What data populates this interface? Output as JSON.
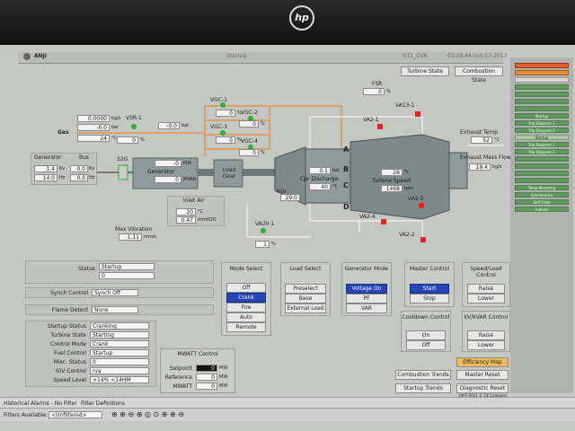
{
  "header": {
    "app_name": "ANJI",
    "screen_name": "Startup",
    "unit_name": "GT1_GVR",
    "datetime": "03:29:44  Oct-17-2013",
    "tab_turbine_state": "Turbine State",
    "tab_combustion_state": "Combustion State"
  },
  "bezel": {
    "logo": "hp"
  },
  "sidebar": {
    "items": [
      "",
      "",
      "",
      "",
      "",
      "",
      "",
      "Startup",
      "Trip Diagram 1",
      "Trip Diagram 2",
      "",
      "",
      "",
      "",
      "Temp Matching",
      "Synchronize",
      "Self Code",
      "Indices"
    ]
  },
  "gas": {
    "label": "Gas",
    "flow": "0.0000",
    "flow_unit": "kg/s",
    "pressure": "-0.0",
    "pressure_unit": "bar",
    "temp": "24",
    "temp_unit": "°C",
    "vsr_label": "VSR-1",
    "vsr_val": "0",
    "vsr_unit": "%",
    "p2_val": "-0.0",
    "p2_unit": "bar"
  },
  "vgc": [
    {
      "label": "VGC-1",
      "val": "0",
      "unit": "%"
    },
    {
      "label": "VGC-2",
      "val": "0",
      "unit": "%"
    },
    {
      "label": "VGC-3",
      "val": "0",
      "unit": "%"
    },
    {
      "label": "VGC-4",
      "val": "0",
      "unit": "%"
    }
  ],
  "fsr": {
    "label": "FSR",
    "val": "0",
    "unit": "%"
  },
  "generator_box": {
    "title": "Generator",
    "kv": "1.4",
    "kv_unit": "Kv",
    "hz": "14.0",
    "hz_unit": "Hz"
  },
  "bus_box": {
    "title": "Bus",
    "kv": "0.0",
    "kv_unit": "Kv",
    "hz": "0.0",
    "hz_unit": "Hz"
  },
  "breaker": {
    "label": "52G"
  },
  "generator": {
    "label": "Generator",
    "mw": "-0",
    "mw_unit": "MW",
    "mvar": "0",
    "mvar_unit": "MVAR"
  },
  "load_gear": {
    "label": "Load Gear"
  },
  "inlet_air": {
    "title": "Inlet Air",
    "temp": "20",
    "temp_unit": "°C",
    "press": "0.47",
    "press_unit": "mmH2O"
  },
  "max_vibration": {
    "label": "Max Vibration",
    "val": "1.11",
    "unit": "mm/s"
  },
  "igv": {
    "label": "IGV",
    "val": "29.0"
  },
  "cpd": {
    "label": "Cpr Discharge",
    "p": "0.1",
    "p_unit": "bar",
    "t": "40",
    "t_unit": "°C"
  },
  "turbine_speed": {
    "label": "Turbine Speed",
    "pct": "28",
    "pct_unit": "%",
    "rpm": "1468",
    "rpm_unit": "rpm"
  },
  "exhaust": {
    "temp_label": "Exhaust Temp",
    "temp": "52",
    "temp_unit": "°C",
    "flow_label": "Exhaust Mass Flow",
    "flow": "18.4",
    "flow_unit": "kg/s"
  },
  "valves": {
    "va13": "VA13-1",
    "va21": "VA2-1",
    "va23": "VA2-3",
    "va24": "VA2-4",
    "va22": "VA2-2",
    "va20": "VA20-1",
    "va20_val": "1",
    "va20_unit": "%"
  },
  "letters": [
    "A",
    "B",
    "C",
    "D"
  ],
  "status_panel": {
    "status_label": "Status",
    "status_val": "Startup",
    "status_val2": "0"
  },
  "synch": {
    "label": "Synch Control",
    "val": "Synch Off"
  },
  "flame": {
    "label": "Flame Detect",
    "val": "None"
  },
  "details": [
    {
      "label": "Startup Status",
      "val": "Cranking"
    },
    {
      "label": "Turbine State",
      "val": "Starting"
    },
    {
      "label": "Control Mode",
      "val": "Crank"
    },
    {
      "label": "Fuel Control",
      "val": "Startup"
    },
    {
      "label": "Misc. Status",
      "val": "0"
    },
    {
      "label": "IGV Control",
      "val": "n/a"
    },
    {
      "label": "Speed Level",
      "val": ">14% <14HM"
    }
  ],
  "mwatt": {
    "title": "MWATT Control",
    "setpoint_label": "Setpoint",
    "setpoint_val": "0",
    "setpoint_unit": "MW",
    "reference_label": "Reference",
    "reference_val": "0",
    "reference_unit": "MW",
    "mwatt_label": "MWATT",
    "mwatt_val": "0",
    "mwatt_unit": "MW"
  },
  "mode_select": {
    "title": "Mode Select",
    "items": [
      "Off",
      "Crank",
      "Fire",
      "Auto",
      "Remote"
    ],
    "selected": "Crank"
  },
  "load_select": {
    "title": "Load Select",
    "items": [
      "Preselect",
      "Base",
      "External Load"
    ]
  },
  "gen_mode": {
    "title": "Generator Mode",
    "items": [
      "Voltage On",
      "PF",
      "VAR"
    ],
    "selected": "Voltage On"
  },
  "master_control": {
    "title": "Master Control",
    "items": [
      "Start",
      "Stop"
    ],
    "selected": "Start"
  },
  "speed_load": {
    "title": "Speed/Load Control",
    "items": [
      "Raise",
      "Lower"
    ]
  },
  "cooldown": {
    "title": "Cooldown Control",
    "items": [
      "On",
      "Off"
    ]
  },
  "kv_var": {
    "title": "kV/kVAR Control",
    "items": [
      "Raise",
      "Lower"
    ]
  },
  "bottom_buttons": {
    "combustion_trends": "Combustion Trends",
    "startup_trends": "Startup Trends",
    "efficiency_map": "Efficiency Map",
    "master_reset": "Master Reset",
    "diagnostic_reset": "Diagnostic Reset"
  },
  "footer": {
    "copyright": "1997-2011 © GE Company",
    "rights": "All rights reserved"
  },
  "taskbar": {
    "alarms": "Historical Alarms - No Filter",
    "filter_defs": "Filter Definitions",
    "filters_label": "Filters Available:",
    "filter_select": "<Unfiltered>"
  },
  "colors": {
    "selected_blue": "#2646b7",
    "valve_green": "#2fae3a",
    "valve_red": "#e52424",
    "side_green": "#5e9a5e",
    "pipe_orange": "#e08a3a"
  }
}
